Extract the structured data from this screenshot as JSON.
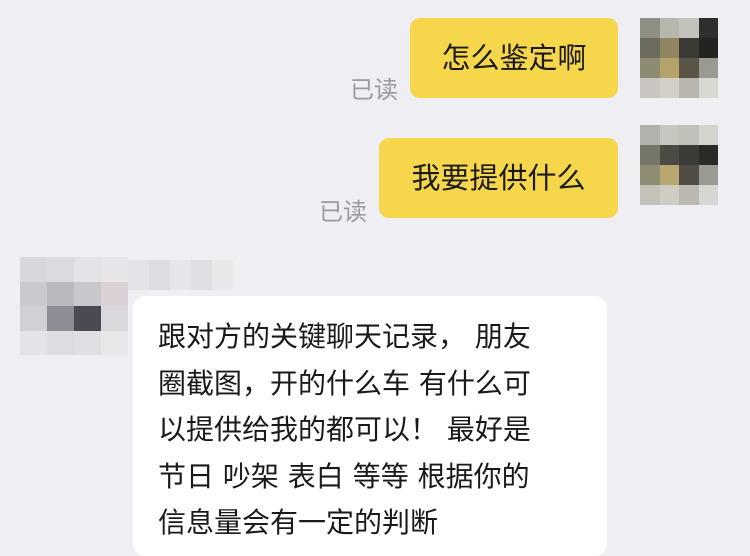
{
  "conversation": {
    "outgoing": [
      {
        "text": "怎么鉴定啊",
        "status": "已读"
      },
      {
        "text": "我要提供什么",
        "status": "已读"
      }
    ],
    "incoming": {
      "lines": [
        "跟对方的关键聊天记录， 朋友",
        "圈截图，开的什么车 有什么可",
        "以提供给我的都可以！ 最好是",
        "节日 吵架 表白 等等 根据你的",
        "信息量会有一定的判断"
      ]
    }
  },
  "colors": {
    "background": "#eeeef3",
    "outgoing_bubble": "#f6d64a",
    "incoming_bubble": "#ffffff",
    "receipt_text": "#9a9aa0"
  },
  "avatars": {
    "self_icon": "blurred-avatar-icon",
    "contact_icon": "blurred-avatar-icon"
  }
}
